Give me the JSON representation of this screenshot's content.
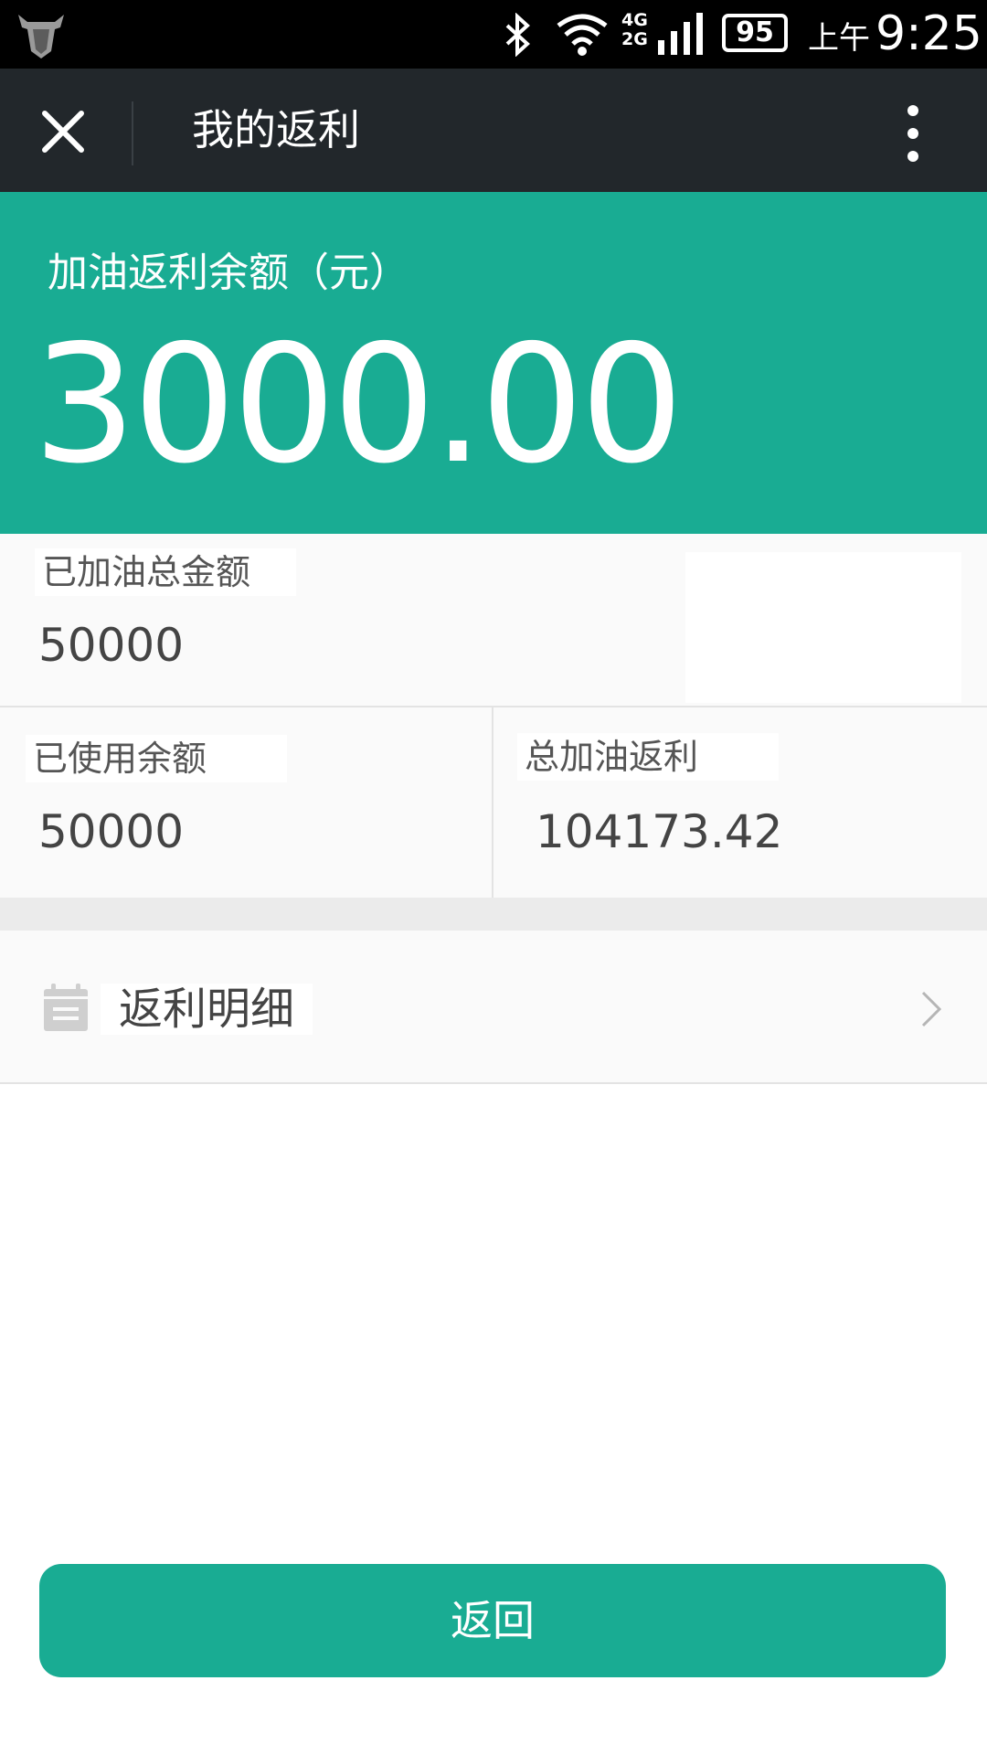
{
  "status_bar": {
    "network_label": "4G\n2G",
    "battery_level": "95",
    "time_prefix": "上午",
    "time": "9:25"
  },
  "title_bar": {
    "title": "我的返利"
  },
  "balance": {
    "label": "加油返利余额（元）",
    "amount": "3000.00"
  },
  "stats": {
    "total_fueled_label": "已加油总金额",
    "total_fueled_value": "50000",
    "used_balance_label": "已使用余额",
    "used_balance_value": "50000",
    "total_rebate_label": "总加油返利",
    "total_rebate_value": "104173.42"
  },
  "list": {
    "rebate_detail_label": "返利明细"
  },
  "actions": {
    "back_label": "返回"
  },
  "colors": {
    "accent": "#19ac93",
    "title_bar": "#22272b"
  },
  "icons": [
    "shield-icon",
    "bluetooth-icon",
    "wifi-icon",
    "signal-icon",
    "battery-icon",
    "close-icon",
    "more-icon",
    "calendar-icon",
    "chevron-right-icon"
  ]
}
